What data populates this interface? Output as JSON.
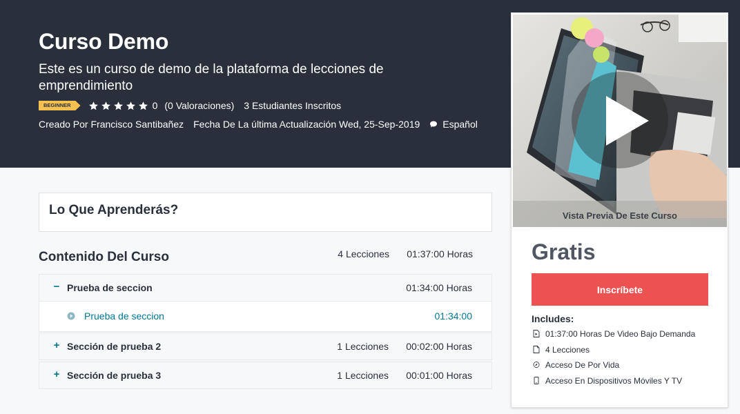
{
  "course": {
    "title": "Curso Demo",
    "subtitle": "Este es un curso de demo de la plataforma de lecciones de emprendimiento",
    "level_badge": "BEGINNER",
    "rating": "0",
    "rating_count": "(0 Valoraciones)",
    "students": "3 Estudiantes Inscritos",
    "creator": "Creado Por Francisco Santibañez",
    "updated": "Fecha De La última Actualización Wed, 25-Sep-2019",
    "language": "Español"
  },
  "learn": {
    "title": "Lo Que Aprenderás?"
  },
  "content": {
    "title": "Contenido Del Curso",
    "lessons": "4 Lecciones",
    "hours": "01:37:00 Horas",
    "sections": [
      {
        "toggle": "−",
        "title": "Prueba de seccion",
        "lessons": "",
        "hours": "01:34:00 Horas",
        "lectures": [
          {
            "title": "Prueba de seccion",
            "time": "01:34:00"
          }
        ]
      },
      {
        "toggle": "+",
        "title": "Sección de prueba 2",
        "lessons": "1 Lecciones",
        "hours": "00:02:00 Horas"
      },
      {
        "toggle": "+",
        "title": "Sección de prueba 3",
        "lessons": "1 Lecciones",
        "hours": "00:01:00 Horas"
      }
    ]
  },
  "sidebar": {
    "preview_label": "Vista Previa De Este Curso",
    "price": "Gratis",
    "enroll_label": "Inscríbete",
    "includes_title": "Includes:",
    "includes": [
      {
        "icon": "video-file-icon",
        "text": "01:37:00 Horas De Video Bajo Demanda"
      },
      {
        "icon": "file-icon",
        "text": "4 Lecciones"
      },
      {
        "icon": "compass-icon",
        "text": "Acceso De Por Vida"
      },
      {
        "icon": "mobile-icon",
        "text": "Acceso En Dispositivos Móviles Y TV"
      }
    ]
  },
  "colors": {
    "hero_bg": "#29303b",
    "badge": "#f4c150",
    "accent": "#007791",
    "enroll": "#ec5252"
  }
}
